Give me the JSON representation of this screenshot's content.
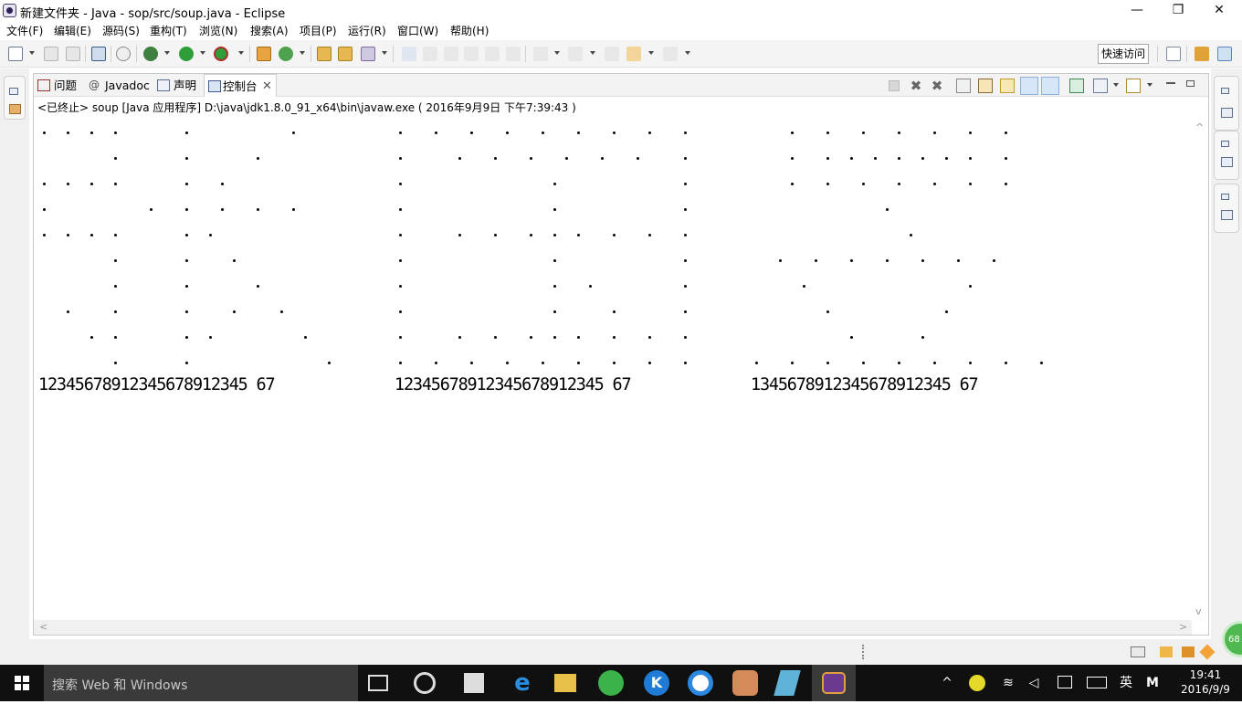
{
  "window": {
    "title": "新建文件夹 - Java - sop/src/soup.java - Eclipse",
    "controls": {
      "minimize": "—",
      "maximize": "❐",
      "close": "✕"
    }
  },
  "menu": [
    "文件(F)",
    "编辑(E)",
    "源码(S)",
    "重构(T)",
    "浏览(N)",
    "搜索(A)",
    "项目(P)",
    "运行(R)",
    "窗口(W)",
    "帮助(H)"
  ],
  "toolbar": {
    "quick_access": "快速访问"
  },
  "tabs": [
    {
      "label": "问题",
      "icon": "problems-icon"
    },
    {
      "label": "Javadoc",
      "icon": "at-sign-icon"
    },
    {
      "label": "声明",
      "icon": "declaration-icon"
    },
    {
      "label": "控制台",
      "icon": "console-icon",
      "active": true
    }
  ],
  "tab_close": "✕",
  "console": {
    "status": "<已终止> soup [Java 应用程序] D:\\java\\jdk1.8.0_91_x64\\bin\\javaw.exe ( 2016年9月9日 下午7:39:43 )",
    "blocks": [
      {
        "label": "12345678912345678912345 67"
      },
      {
        "label": "12345678912345678912345 67"
      },
      {
        "label": "1345678912345678912345 67"
      }
    ],
    "number_lines": [
      "12345678912345678912345 67",
      "12345678912345678912345 67",
      "1345678912345678912345 67"
    ]
  },
  "taskbar": {
    "search_placeholder": "搜索 Web 和 Windows",
    "ime": "英",
    "ime_mode": "M",
    "time": "19:41",
    "date": "2016/9/9",
    "badge": "68"
  }
}
